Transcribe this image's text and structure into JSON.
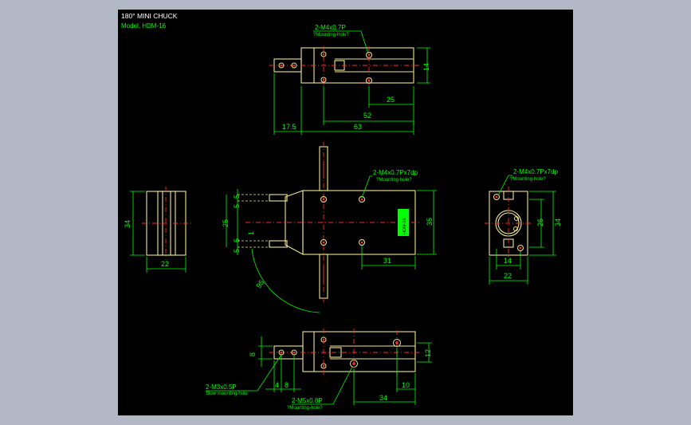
{
  "title": {
    "line1": "180° MINI CHUCK",
    "line2": "Model, HDM-16"
  },
  "top_view": {
    "hole_callout": "2-M4x0.7P",
    "hole_note": "?Mounting-hole?",
    "dims": {
      "height": "14",
      "d25": "25",
      "d52": "52",
      "d17_5": "17.5",
      "d63": "63"
    }
  },
  "side_view_left": {
    "dims": {
      "height": "34",
      "width": "22"
    }
  },
  "front_view": {
    "hole_callout": "2-M4x0.7Px7dp",
    "hole_note": "?Mounting-hole?",
    "dims": {
      "a5_top": "5",
      "b5_top": "5",
      "d25": "25",
      "d1": "1",
      "a5_bot": "5",
      "b5_bot": "5",
      "d35": "35",
      "d31": "31",
      "angle": "95"
    },
    "label_plate": "HDM-16"
  },
  "side_view_right": {
    "hole_callout": "2-M4x0.7Px7dp",
    "hole_note": "?Mounting-hole?",
    "dims": {
      "d34": "34",
      "d26": "26",
      "d14": "14",
      "d22": "22"
    }
  },
  "bottom_view": {
    "hole_callout_left": "2-M3x0.5P",
    "hole_note_left": "Slow mounting-hole",
    "hole_callout_right": "2-M5x0.8P",
    "hole_note_right": "?Mounting-hole?",
    "dims": {
      "d8": "8",
      "d12": "12",
      "d4": "4",
      "d8b": "8",
      "d34": "34",
      "d10": "10"
    }
  }
}
